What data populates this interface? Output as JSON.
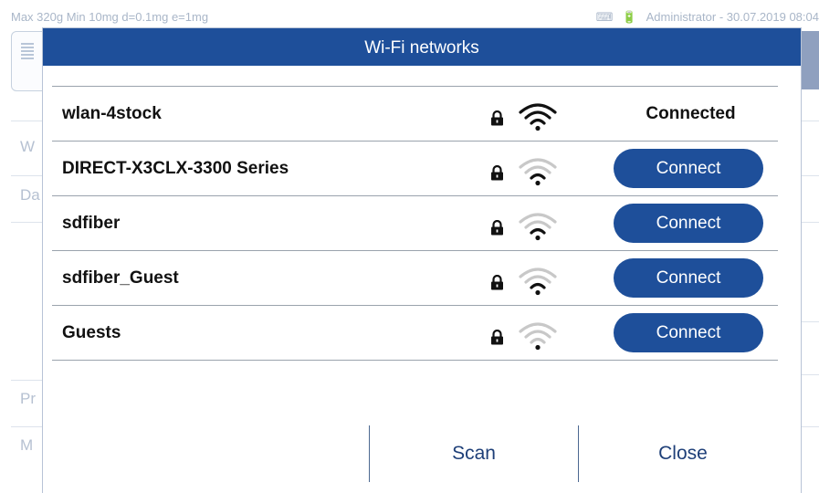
{
  "status_bar": {
    "scale_info": "Max 320g  Min 10mg  d=0.1mg  e=1mg",
    "user": "Administrator",
    "datetime": "30.07.2019 08:04",
    "separator": "-"
  },
  "background": {
    "letters": [
      "W",
      "Da",
      "Pr",
      "M"
    ]
  },
  "dialog": {
    "title": "Wi-Fi networks",
    "networks": [
      {
        "name": "wlan-4stock",
        "secured": true,
        "signal_bars": 3,
        "state": "connected",
        "status_label": "Connected"
      },
      {
        "name": "DIRECT-X3CLX-3300 Series",
        "secured": true,
        "signal_bars": 1,
        "state": "available",
        "action_label": "Connect"
      },
      {
        "name": "sdfiber",
        "secured": true,
        "signal_bars": 1,
        "state": "available",
        "action_label": "Connect"
      },
      {
        "name": "sdfiber_Guest",
        "secured": true,
        "signal_bars": 1,
        "state": "available",
        "action_label": "Connect"
      },
      {
        "name": "Guests",
        "secured": true,
        "signal_bars": 0,
        "state": "available",
        "action_label": "Connect"
      }
    ],
    "scan_label": "Scan",
    "close_label": "Close"
  },
  "colors": {
    "accent": "#1e4f9a",
    "wifi_active": "#111111",
    "wifi_inactive": "#c8c8c8"
  }
}
